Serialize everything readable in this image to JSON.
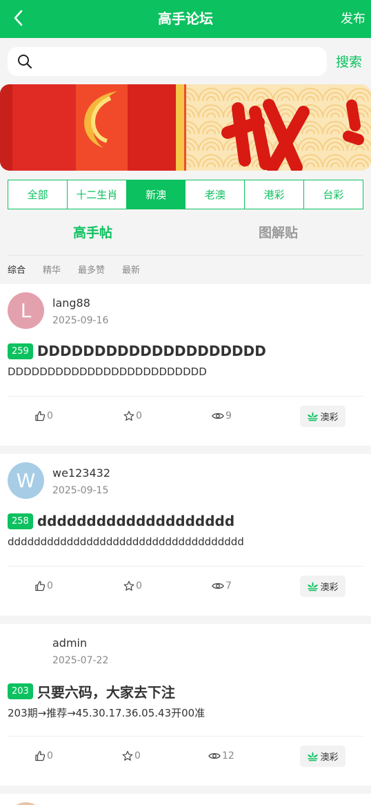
{
  "header": {
    "title": "高手论坛",
    "publish": "发布"
  },
  "search": {
    "placeholder": "",
    "button": "搜索"
  },
  "regions": [
    "全部",
    "十二生肖",
    "新澳",
    "老澳",
    "港彩",
    "台彩"
  ],
  "post_tabs": [
    "高手帖",
    "图解贴"
  ],
  "sorts": [
    "综合",
    "精华",
    "最多赞",
    "最新"
  ],
  "posts": [
    {
      "avatar_letter": "L",
      "avatar_color": "#e3a1ad",
      "user": "lang88",
      "date": "2025-09-16",
      "issue": "259",
      "title": "DDDDDDDDDDDDDDDDDDDD",
      "body": "DDDDDDDDDDDDDDDDDDDDDDDDD",
      "likes": "0",
      "favs": "0",
      "views": "9",
      "tag": "澳彩"
    },
    {
      "avatar_letter": "W",
      "avatar_color": "#a7cde6",
      "user": "we123432",
      "date": "2025-09-15",
      "issue": "258",
      "title": "dddddddddddddddddddd",
      "body": "dddddddddddddddddddddddddddddddddddd",
      "likes": "0",
      "favs": "0",
      "views": "7",
      "tag": "澳彩"
    },
    {
      "avatar_letter": "",
      "avatar_color": "#ffffff",
      "user": "admin",
      "date": "2025-07-22",
      "issue": "203",
      "title": "只要六码，大家去下注",
      "body": "203期→推荐→45.30.17.36.05.43开00准",
      "likes": "0",
      "favs": "0",
      "views": "12",
      "tag": "澳彩"
    }
  ],
  "colors": {
    "accent": "#0cc15f"
  }
}
